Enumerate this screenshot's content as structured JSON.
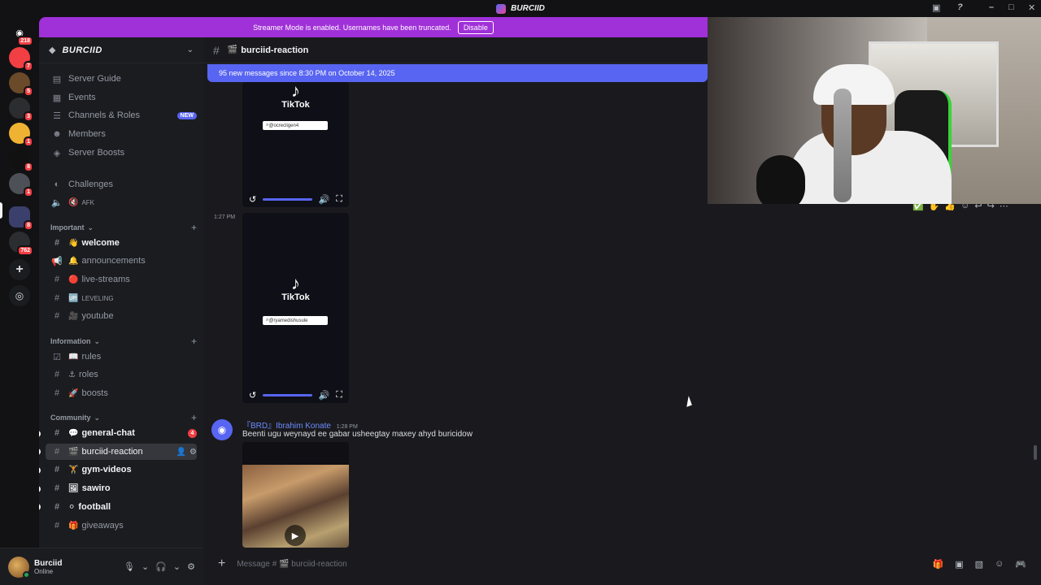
{
  "window": {
    "title": "BURCIID"
  },
  "servers": [
    {
      "label": "218",
      "badge": "218"
    },
    {
      "label": "",
      "badge": "7"
    },
    {
      "label": "",
      "badge": "5"
    },
    {
      "label": "",
      "badge": "3"
    },
    {
      "label": "",
      "badge": "1"
    },
    {
      "label": "",
      "badge": "8"
    },
    {
      "label": "",
      "badge": "1"
    },
    {
      "label": "",
      "badge": "8"
    },
    {
      "label": "",
      "badge": "762"
    }
  ],
  "streamer_banner": {
    "text": "Streamer Mode is enabled. Usernames have been truncated.",
    "button": "Disable"
  },
  "guild": {
    "name": "BURCIID"
  },
  "sidebar": {
    "top_items": [
      {
        "label": "Server Guide"
      },
      {
        "label": "Events"
      },
      {
        "label": "Channels & Roles",
        "tag": "NEW"
      },
      {
        "label": "Members"
      },
      {
        "label": "Server Boosts"
      }
    ],
    "challenges": "Challenges",
    "afk": "AFK",
    "categories": {
      "important": "Important",
      "information": "Information",
      "community": "Community"
    },
    "important_channels": [
      {
        "label": "welcome",
        "emoji": "👋"
      },
      {
        "label": "announcements",
        "emoji": "🔔"
      },
      {
        "label": "live-streams",
        "emoji": "🔴"
      },
      {
        "label": "LEVELING",
        "emoji": "🆙"
      },
      {
        "label": "youtube",
        "emoji": "🎥"
      }
    ],
    "information_channels": [
      {
        "label": "rules",
        "emoji": "📖"
      },
      {
        "label": "roles",
        "emoji": "⚓"
      },
      {
        "label": "boosts",
        "emoji": "🚀"
      }
    ],
    "community_channels": [
      {
        "label": "general-chat",
        "emoji": "💬",
        "mention": "4"
      },
      {
        "label": "burciid-reaction",
        "emoji": "🎬"
      },
      {
        "label": "gym-videos",
        "emoji": "🏋"
      },
      {
        "label": "sawiro",
        "emoji": "🖼"
      },
      {
        "label": "football",
        "emoji": "⚪"
      },
      {
        "label": "giveaways",
        "emoji": "🎁"
      }
    ]
  },
  "user": {
    "name": "Burciid",
    "status": "Online"
  },
  "channel": {
    "name": "burciid-reaction"
  },
  "new_messages_bar": "95 new messages since 8:30 PM on October 14, 2025",
  "videos": [
    {
      "brand": "TikTok",
      "search": "@ocrecligen4"
    },
    {
      "brand": "TikTok",
      "search": "@ryamedishusule",
      "timestamp": "1:27 PM"
    }
  ],
  "message": {
    "author": "『BRD』Ibrahim Konate",
    "time": "1:28 PM",
    "text": "Beenti ugu weynayd ee gabar usheegtay maxey ahyd buricidow"
  },
  "composer": {
    "placeholder": "Message # 🎬 burciid-reaction"
  }
}
